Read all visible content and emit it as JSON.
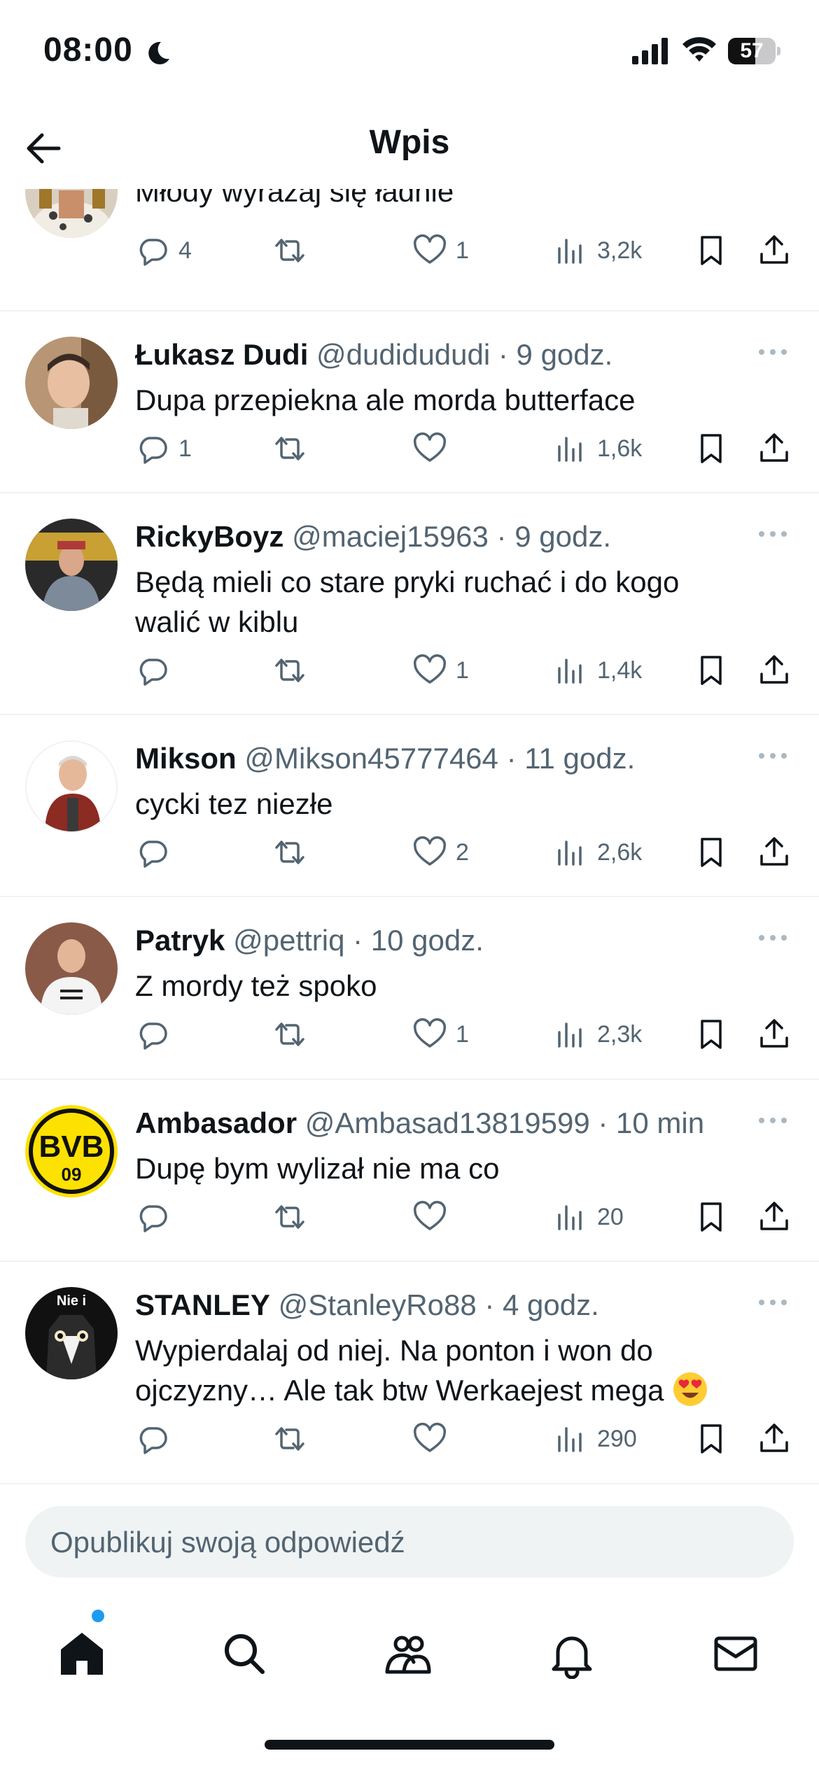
{
  "status_bar": {
    "time": "08:00",
    "battery": "57",
    "battery_level": 0.57
  },
  "header": {
    "title": "Wpis"
  },
  "tweets": [
    {
      "body": "Młody wyrażaj się ładnie",
      "replies": "4",
      "retweets": "",
      "likes": "1",
      "views": "3,2k"
    },
    {
      "name": "Łukasz Dudi",
      "meta": "@dudidududi · 9 godz.",
      "body": "Dupa przepiekna ale morda butterface",
      "replies": "1",
      "retweets": "",
      "likes": "",
      "views": "1,6k"
    },
    {
      "name": "RickyBoyz",
      "meta": "@maciej15963 · 9 godz.",
      "body": "Będą mieli co stare pryki ruchać i do kogo walić w kiblu",
      "replies": "",
      "retweets": "",
      "likes": "1",
      "views": "1,4k"
    },
    {
      "name": "Mikson",
      "meta": "@Mikson45777464 · 11 godz.",
      "body": "cycki tez niezłe",
      "replies": "",
      "retweets": "",
      "likes": "2",
      "views": "2,6k"
    },
    {
      "name": "Patryk",
      "meta": "@pettriq · 10 godz.",
      "body": "Z mordy też spoko",
      "replies": "",
      "retweets": "",
      "likes": "1",
      "views": "2,3k"
    },
    {
      "name": "Ambasador",
      "meta": "@Ambasad13819599 · 10 min",
      "body": "Dupę bym wylizał nie ma co",
      "replies": "",
      "retweets": "",
      "likes": "",
      "views": "20",
      "avatar_text": "BVB",
      "avatar_subtext": "09"
    },
    {
      "name": "STANLEY",
      "meta": "@StanleyRo88 · 4 godz.",
      "body": "Wypierdalaj od niej. Na ponton i won do ojczyzny… Ale tak btw Werkaejest mega",
      "replies": "",
      "retweets": "",
      "likes": "",
      "views": "290",
      "avatar_text": "Nie i"
    }
  ],
  "reply_bar": {
    "placeholder": "Opublikuj swoją odpowiedź"
  },
  "colors": {
    "accent": "#1d9bf0",
    "text": "#0f1419",
    "muted": "#536471",
    "divider": "#eff3f4"
  },
  "icons": {
    "reply": "speech-bubble-icon",
    "retweet": "retweet-arrows-icon",
    "like": "heart-icon",
    "views": "bar-chart-icon",
    "bookmark": "bookmark-icon",
    "share": "share-upload-icon"
  }
}
